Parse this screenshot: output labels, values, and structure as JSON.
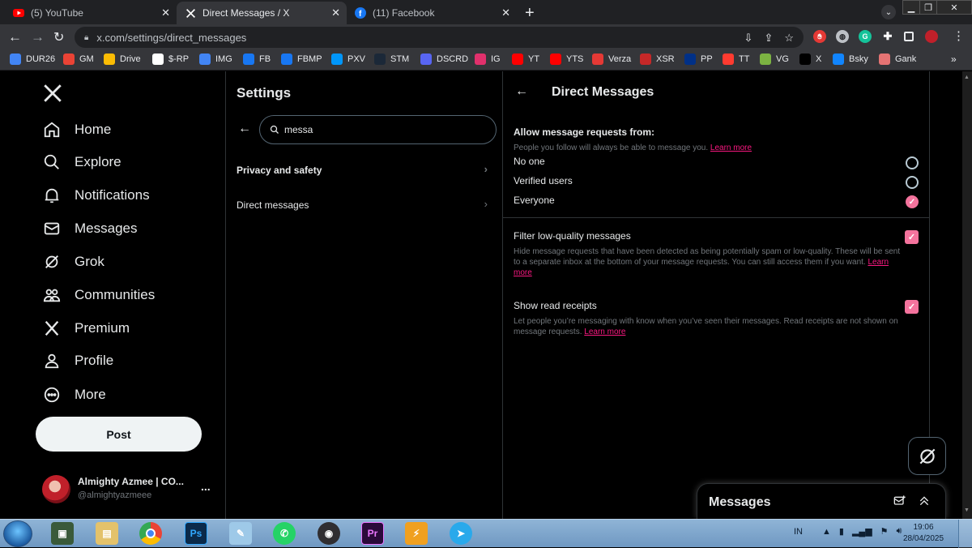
{
  "browser": {
    "tabs": [
      {
        "label": "(5) YouTube",
        "icon": "youtube-icon"
      },
      {
        "label": "Direct Messages / X",
        "icon": "x-icon"
      },
      {
        "label": "(11) Facebook",
        "icon": "facebook-icon"
      }
    ],
    "url": "x.com/settings/direct_messages",
    "bookmarks": [
      {
        "label": "DUR26",
        "color": "#4285f4"
      },
      {
        "label": "GM",
        "color": "#ea4335"
      },
      {
        "label": "Drive",
        "color": "#fbbc04"
      },
      {
        "label": "$-RP",
        "color": "#ffffff"
      },
      {
        "label": "IMG",
        "color": "#4285f4"
      },
      {
        "label": "FB",
        "color": "#1877f2"
      },
      {
        "label": "FBMP",
        "color": "#1877f2"
      },
      {
        "label": "PXV",
        "color": "#0096fa"
      },
      {
        "label": "STM",
        "color": "#1b2838"
      },
      {
        "label": "DSCRD",
        "color": "#5865f2"
      },
      {
        "label": "IG",
        "color": "#e1306c"
      },
      {
        "label": "YT",
        "color": "#ff0000"
      },
      {
        "label": "YTS",
        "color": "#ff0000"
      },
      {
        "label": "Verza",
        "color": "#e53935"
      },
      {
        "label": "XSR",
        "color": "#c62828"
      },
      {
        "label": "PP",
        "color": "#003087"
      },
      {
        "label": "TT",
        "color": "#ff3b30"
      },
      {
        "label": "VG",
        "color": "#7cb342"
      },
      {
        "label": "X",
        "color": "#000000"
      },
      {
        "label": "Bsky",
        "color": "#1185fe"
      },
      {
        "label": "Gank",
        "color": "#e57373"
      }
    ],
    "bookmarks_overflow": "»"
  },
  "nav": {
    "items": [
      {
        "label": "Home",
        "icon": "home-icon"
      },
      {
        "label": "Explore",
        "icon": "search-icon"
      },
      {
        "label": "Notifications",
        "icon": "bell-icon"
      },
      {
        "label": "Messages",
        "icon": "envelope-icon"
      },
      {
        "label": "Grok",
        "icon": "grok-icon"
      },
      {
        "label": "Communities",
        "icon": "people-icon"
      },
      {
        "label": "Premium",
        "icon": "x-icon"
      },
      {
        "label": "Profile",
        "icon": "person-icon"
      },
      {
        "label": "More",
        "icon": "more-circle-icon"
      }
    ],
    "post_label": "Post",
    "account": {
      "name": "Almighty Azmee | CO...",
      "handle": "@almightyazmeee",
      "more": "..."
    }
  },
  "settings": {
    "title": "Settings",
    "search_value": "messa",
    "results": [
      {
        "label": "Privacy and safety",
        "bold": true
      },
      {
        "label": "Direct messages",
        "bold": false
      }
    ]
  },
  "dm_settings": {
    "title": "Direct Messages",
    "allow_title": "Allow message requests from:",
    "allow_note": "People you follow will always be able to message you.",
    "learn_more": "Learn more",
    "options": [
      {
        "label": "No one",
        "selected": false
      },
      {
        "label": "Verified users",
        "selected": false
      },
      {
        "label": "Everyone",
        "selected": true
      }
    ],
    "filter_label": "Filter low-quality messages",
    "filter_checked": true,
    "filter_note_1": "Hide message requests that have been detected as being potentially spam or low-quality. These will be sent",
    "filter_note_2": "to a separate inbox at the bottom of your message requests. You can still access them if you want.",
    "filter_learn_a": "Learn",
    "filter_learn_b": "more",
    "receipts_label": "Show read receipts",
    "receipts_checked": true,
    "receipts_note_1": "Let people you’re messaging with know when you’ve seen their messages. Read receipts are not shown on",
    "receipts_note_2": "message requests.",
    "receipts_learn": "Learn more"
  },
  "messages_drawer": {
    "title": "Messages"
  },
  "taskbar": {
    "apps": [
      "computer-icon",
      "explorer-icon",
      "chrome-icon",
      "photoshop-icon",
      "notepad-icon",
      "whatsapp-icon",
      "obs-icon",
      "premiere-icon",
      "winamp-icon",
      "telegram-icon"
    ],
    "ps_label": "Ps",
    "pr_label": "Pr",
    "lang": "IN",
    "time": "19:06",
    "date": "28/04/2025"
  },
  "colors": {
    "accent": "#f4739d",
    "link": "#f91880",
    "muted": "#71767b"
  }
}
